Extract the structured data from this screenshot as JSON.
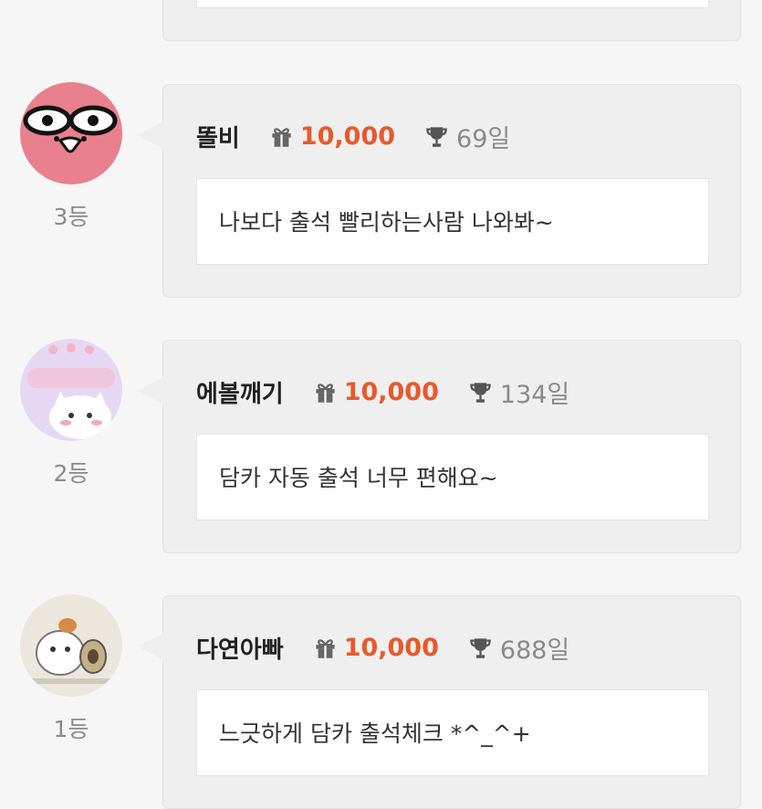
{
  "entries": [
    {
      "name": "똘비",
      "points": "10,000",
      "days": "69일",
      "rank": "3등",
      "message": "나보다 출석 빨리하는사람 나와봐~"
    },
    {
      "name": "에볼깨기",
      "points": "10,000",
      "days": "134일",
      "rank": "2등",
      "message": "담카 자동 출석 너무 편해요~"
    },
    {
      "name": "다연아빠",
      "points": "10,000",
      "days": "688일",
      "rank": "1등",
      "message": "느긋하게 담카 출석체크 *^_^+"
    }
  ],
  "icons": {
    "points": "gift-icon",
    "days": "trophy-icon"
  },
  "colors": {
    "points": "#e8592b",
    "card_bg": "#efefef",
    "text": "#222222",
    "muted": "#8a8a8a"
  }
}
